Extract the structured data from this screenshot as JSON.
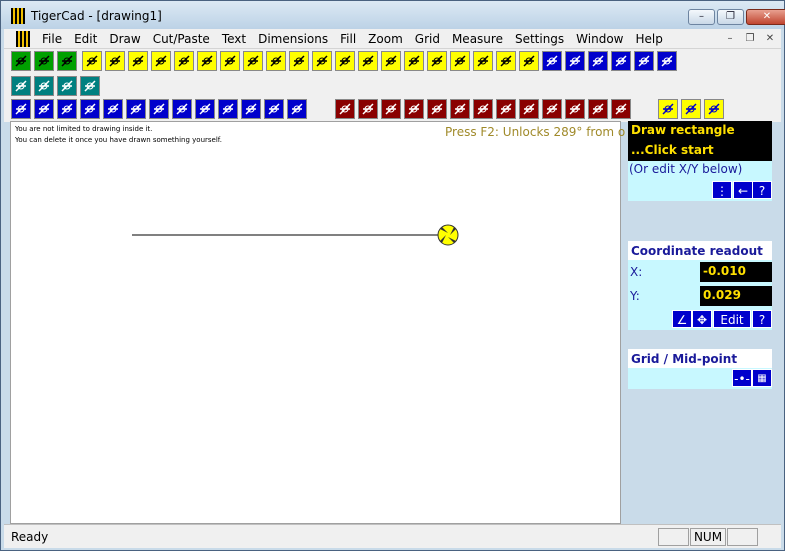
{
  "window": {
    "title": "TigerCad - [drawing1]"
  },
  "menu": [
    "File",
    "Edit",
    "Draw",
    "Cut/Paste",
    "Text",
    "Dimensions",
    "Fill",
    "Zoom",
    "Grid",
    "Measure",
    "Settings",
    "Window",
    "Help"
  ],
  "window_controls": {
    "minimize": "–",
    "restore": "❐",
    "close": "✕",
    "mdi_minimize": "–",
    "mdi_restore": "❐",
    "mdi_close": "✕"
  },
  "toolbar1_icons": [
    "layer-green-icon",
    "zoom-out-icon",
    "zoom-in-icon",
    "line-icon",
    "polyline-icon",
    "rectangle-icon",
    "arc-icon",
    "arc2-icon",
    "arc3-icon",
    "circle-center-icon",
    "circle-icon",
    "circle3-icon",
    "double-line-icon",
    "triple-line-icon",
    "parallel-line-icon",
    "tangent-icon",
    "curve-icon",
    "curve2-icon",
    "curve3-icon",
    "ellipse-icon",
    "spline-icon",
    "polygon-icon",
    "hatch-icon"
  ],
  "toolbar1_right_icons": [
    "move-horizontal-icon",
    "move-vertical-icon",
    "move-diagonal-icon",
    "scale-icon",
    "fit-icon",
    "rotate-icon"
  ],
  "toolbar2_icons": [
    "snap-12-icon",
    "snap-grid-icon",
    "grid-dots-icon",
    "no-snap-icon"
  ],
  "toolbar3_blue_icons": [
    "curve-edit-icon",
    "curve-edit2-icon",
    "delete-object-icon",
    "point-edit-icon",
    "break-icon",
    "trim-icon",
    "extend-icon",
    "array-icon",
    "offset-icon",
    "fillet-icon",
    "chamfer-icon",
    "mirror-icon",
    "fill-icon"
  ],
  "toolbar3_red_icons": [
    "house-icon",
    "house2-icon",
    "dot-icon",
    "dots-icon",
    "shape-icon",
    "symbol-icon",
    "text-symbol-icon",
    "text-ab-icon",
    "text-ab2-icon",
    "text-ab3-icon",
    "text-x-icon",
    "text-a-icon",
    "escape-icon"
  ],
  "toolbar3_yellow_icons": [
    "select-icon",
    "select2-icon",
    "select3-icon"
  ],
  "canvas": {
    "note1": "You are not limited to drawing inside it.",
    "note2": "You can delete it once you have drawn something yourself.",
    "hint": "Press F2: Unlocks 289° from o"
  },
  "panel": {
    "status_title": "Draw rectangle",
    "status_sub": "...Click start",
    "status_hint": "(Or edit X/Y below)",
    "coord_title": "Coordinate readout",
    "x_label": "X:",
    "x_value": "-0.010",
    "y_label": "Y:",
    "y_value": "0.029",
    "edit_label": "Edit",
    "help_label": "?",
    "grid_title": "Grid / Mid-point"
  },
  "status": {
    "text": "Ready",
    "num": "NUM"
  }
}
